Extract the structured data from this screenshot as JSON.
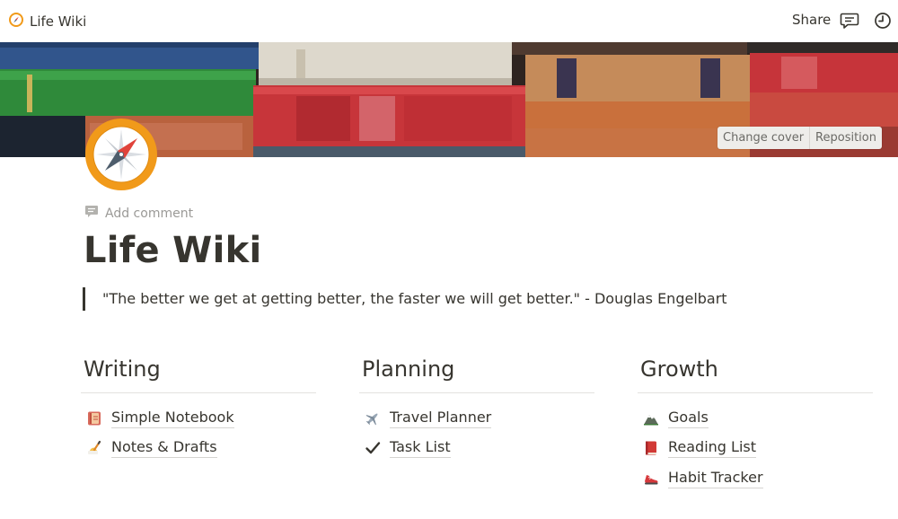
{
  "topbar": {
    "breadcrumb_title": "Life Wiki",
    "share_label": "Share",
    "comments_icon": "comment-icon",
    "history_icon": "clock-icon"
  },
  "cover": {
    "change_cover_label": "Change cover",
    "reposition_label": "Reposition"
  },
  "page": {
    "icon": "compass-icon",
    "add_comment_label": "Add comment",
    "title": "Life Wiki",
    "quote": "\"The better we get at getting better, the faster we will get better.\" - Douglas Engelbart"
  },
  "columns": [
    {
      "heading": "Writing",
      "items": [
        {
          "label": "Simple Notebook",
          "icon": "notebook-icon"
        },
        {
          "label": "Notes & Drafts",
          "icon": "writing-hand-icon"
        }
      ]
    },
    {
      "heading": "Planning",
      "items": [
        {
          "label": "Travel Planner",
          "icon": "airplane-icon"
        },
        {
          "label": "Task List",
          "icon": "checkmark-icon"
        }
      ]
    },
    {
      "heading": "Growth",
      "items": [
        {
          "label": "Goals",
          "icon": "mountain-icon"
        },
        {
          "label": "Reading List",
          "icon": "closed-book-icon"
        },
        {
          "label": "Habit Tracker",
          "icon": "running-shoe-icon"
        }
      ]
    }
  ],
  "colors": {
    "text": "#37352f",
    "muted": "#9b9a97",
    "compass_ring": "#f19a1a"
  }
}
